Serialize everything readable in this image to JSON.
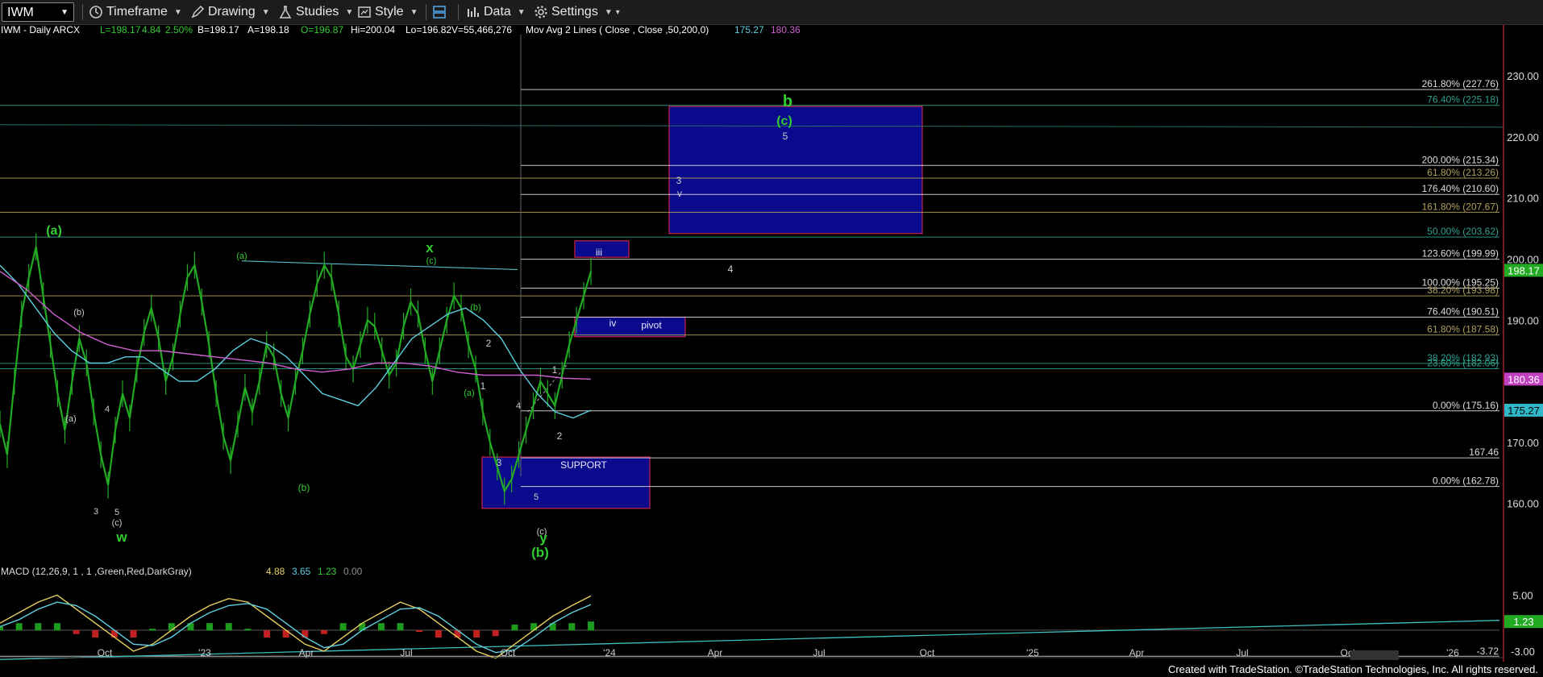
{
  "toolbar": {
    "symbol": "IWM",
    "timeframe": "Timeframe",
    "drawing": "Drawing",
    "studies": "Studies",
    "style": "Style",
    "data": "Data",
    "settings": "Settings"
  },
  "footer": "Created with TradeStation. ©TradeStation Technologies, Inc. All rights reserved.",
  "chart_data": {
    "type": "line",
    "header": {
      "symbol": "IWM - Daily  ARCX",
      "quote": [
        {
          "text": "L=198.17",
          "color": "#33cc33"
        },
        {
          "text": "4.84",
          "color": "#33cc33"
        },
        {
          "text": "2.50%",
          "color": "#33cc33"
        },
        {
          "text": "B=198.17",
          "color": "#ffffff"
        },
        {
          "text": "A=198.18",
          "color": "#ffffff"
        },
        {
          "text": "O=196.87",
          "color": "#33cc33"
        },
        {
          "text": "Hi=200.04",
          "color": "#ffffff"
        },
        {
          "text": "Lo=196.82",
          "color": "#ffffff"
        },
        {
          "text": "V=55,466,276",
          "color": "#ffffff"
        },
        {
          "text": "Mov Avg 2 Lines ( Close , Close ,50,200,0)",
          "color": "#ffffff"
        },
        {
          "text": "175.27",
          "color": "#5ecfe0"
        },
        {
          "text": "180.36",
          "color": "#d060d0"
        }
      ]
    },
    "x_ticks": [
      "Oct",
      "'23",
      "Apr",
      "Jul",
      "Oct",
      "'24",
      "Apr",
      "Jul",
      "Oct",
      "'25",
      "Apr",
      "Jul",
      "Oct",
      "'26"
    ],
    "price_axis": {
      "ylim": [
        156,
        232
      ],
      "ticks": [
        160,
        170,
        180,
        190,
        200,
        210,
        220,
        230
      ]
    },
    "price_series": {
      "name": "IWM",
      "color": "#22aa22",
      "values": [
        173,
        168,
        180,
        191,
        197,
        202,
        194,
        186,
        178,
        172,
        180,
        187,
        183,
        175,
        168,
        163,
        172,
        178,
        174,
        182,
        188,
        192,
        187,
        180,
        184,
        191,
        197,
        199,
        193,
        186,
        178,
        171,
        167,
        173,
        179,
        175,
        180,
        186,
        184,
        178,
        174,
        180,
        185,
        191,
        196,
        199,
        197,
        191,
        184,
        182,
        186,
        190,
        189,
        185,
        181,
        183,
        189,
        193,
        191,
        185,
        180,
        185,
        190,
        194,
        192,
        186,
        182,
        175,
        170,
        166,
        162,
        164,
        168,
        172,
        176,
        180,
        178,
        176,
        181,
        186,
        190,
        194,
        198
      ]
    },
    "ma_series": [
      {
        "name": "MA50",
        "color": "#5ecfe0",
        "values": [
          199,
          196,
          192,
          188,
          185,
          183,
          183,
          184,
          184,
          182,
          180,
          180,
          182,
          185,
          187,
          186,
          184,
          181,
          178,
          177,
          176,
          179,
          183,
          187,
          189,
          191,
          192,
          190,
          187,
          182,
          178,
          175,
          174,
          175.27
        ]
      },
      {
        "name": "MA200",
        "color": "#d060d0",
        "values": [
          198,
          195,
          191,
          188,
          186,
          185,
          185,
          184.5,
          184,
          183.5,
          183,
          182,
          181.5,
          182,
          183,
          183,
          182.5,
          181.5,
          181,
          181,
          181,
          180.5,
          180.36
        ]
      }
    ],
    "right_labels": [
      {
        "text": "198.17",
        "value": 198.17,
        "bg": "#22aa22",
        "fg": "#ffffff"
      },
      {
        "text": "180.36",
        "value": 180.36,
        "bg": "#c040c0",
        "fg": "#ffffff"
      },
      {
        "text": "175.27",
        "value": 175.27,
        "bg": "#30b8c8",
        "fg": "#000000"
      }
    ],
    "fib_levels": [
      {
        "text": "261.80% (227.76)",
        "value": 227.76,
        "color": "#dddddd"
      },
      {
        "text": "76.40% (225.18)",
        "value": 225.18,
        "color": "#2fa090"
      },
      {
        "text": "200.00% (215.34)",
        "value": 215.34,
        "color": "#dddddd"
      },
      {
        "text": "61.80% (213.26)",
        "value": 213.26,
        "color": "#b0a060"
      },
      {
        "text": "176.40% (210.60)",
        "value": 210.6,
        "color": "#dddddd"
      },
      {
        "text": "161.80% (207.67)",
        "value": 207.67,
        "color": "#b0a060"
      },
      {
        "text": "50.00% (203.62)",
        "value": 203.62,
        "color": "#2fa090"
      },
      {
        "text": "123.60% (199.99)",
        "value": 199.99,
        "color": "#dddddd"
      },
      {
        "text": "100.00% (195.25)",
        "value": 195.25,
        "color": "#dddddd"
      },
      {
        "text": "38.20% (193.98)",
        "value": 193.98,
        "color": "#b0a060"
      },
      {
        "text": "76.40% (190.51)",
        "value": 190.51,
        "color": "#dddddd"
      },
      {
        "text": "61.80% (187.58)",
        "value": 187.58,
        "color": "#b0a060"
      },
      {
        "text": "38.20% (182.93)",
        "value": 182.93,
        "color": "#2fa090"
      },
      {
        "text": "23.60% (182.06)",
        "value": 182.06,
        "color": "#2fa090"
      },
      {
        "text": "0.00% (175.16)",
        "value": 175.16,
        "color": "#dddddd"
      },
      {
        "text": "167.46",
        "value": 167.46,
        "color": "#dddddd"
      },
      {
        "text": "0.00% (162.78)",
        "value": 162.78,
        "color": "#dddddd"
      }
    ],
    "zones": [
      {
        "label": "",
        "price_top": 225,
        "price_bottom": 204.2
      },
      {
        "label": "iii",
        "price_top": 203,
        "price_bottom": 200.3
      },
      {
        "label": "iv",
        "price_top": 190.5,
        "price_bottom": 187.3
      },
      {
        "label": "pivot",
        "price_top": 190.5,
        "price_bottom": 187.3
      },
      {
        "label": "SUPPORT",
        "price_top": 167.6,
        "price_bottom": 159.2
      }
    ],
    "wave_labels": [
      {
        "text": "(a)",
        "color": "#33cc33"
      },
      {
        "text": "(b)",
        "color": "#cccccc"
      },
      {
        "text": "(a)",
        "color": "#cccccc"
      },
      {
        "text": "4",
        "color": "#cccccc"
      },
      {
        "text": "3",
        "color": "#cccccc"
      },
      {
        "text": "5",
        "color": "#cccccc"
      },
      {
        "text": "(c)",
        "color": "#cccccc"
      },
      {
        "text": "w",
        "color": "#33cc33"
      },
      {
        "text": "(a)",
        "color": "#33cc33"
      },
      {
        "text": "(b)",
        "color": "#33cc33"
      },
      {
        "text": "x",
        "color": "#33cc33"
      },
      {
        "text": "(c)",
        "color": "#33cc33"
      },
      {
        "text": "(b)",
        "color": "#33cc33"
      },
      {
        "text": "2",
        "color": "#cccccc"
      },
      {
        "text": "1",
        "color": "#cccccc"
      },
      {
        "text": "(a)",
        "color": "#33cc33"
      },
      {
        "text": "4",
        "color": "#cccccc"
      },
      {
        "text": "3",
        "color": "#cccccc"
      },
      {
        "text": "5",
        "color": "#cccccc"
      },
      {
        "text": "(c)",
        "color": "#cccccc"
      },
      {
        "text": "y",
        "color": "#33cc33"
      },
      {
        "text": "(b)",
        "color": "#33cc33"
      },
      {
        "text": "1",
        "color": "#cccccc"
      },
      {
        "text": "2",
        "color": "#cccccc"
      },
      {
        "text": "3",
        "color": "#cccccc"
      },
      {
        "text": "v",
        "color": "#cccccc"
      },
      {
        "text": "4",
        "color": "#cccccc"
      },
      {
        "text": "b",
        "color": "#33cc33"
      },
      {
        "text": "(c)",
        "color": "#33cc33"
      },
      {
        "text": "5",
        "color": "#cccccc"
      }
    ],
    "macd": {
      "title": "MACD (12,26,9, 1 , 1 ,Green,Red,DarkGray)",
      "values": [
        {
          "text": "4.88",
          "color": "#e8d060"
        },
        {
          "text": "3.65",
          "color": "#5ecfe0"
        },
        {
          "text": "1.23",
          "color": "#33cc33"
        },
        {
          "text": "0.00",
          "color": "#909090"
        }
      ],
      "ylim": [
        -4.5,
        7
      ],
      "ticks": [
        {
          "text": "5.00",
          "value": 5
        },
        {
          "text": "-3.00",
          "value": -3
        }
      ],
      "right_labels": [
        {
          "text": "1.23",
          "value": 1.23,
          "bg": "#22aa22"
        }
      ],
      "level_label": {
        "text": "-3.72",
        "value": -3.72
      },
      "macd_line": [
        1,
        2.5,
        4,
        5,
        3,
        1,
        -1,
        -3,
        -2,
        0,
        2,
        3.5,
        4.5,
        4,
        2,
        0,
        -2,
        -3,
        -1,
        1,
        2.5,
        4,
        3,
        1,
        -1,
        -3,
        -4,
        -2,
        0,
        2,
        3.5,
        4.88
      ],
      "signal_line": [
        0.5,
        1.5,
        3,
        4,
        3.5,
        2,
        0,
        -2,
        -2.2,
        -1,
        1,
        2.5,
        3.5,
        3.8,
        3,
        1,
        -1,
        -2.5,
        -2,
        0,
        1.5,
        3,
        3.2,
        2,
        0,
        -2,
        -3.2,
        -2.8,
        -1,
        1,
        2.5,
        3.65
      ],
      "histogram": [
        0.5,
        1,
        1,
        1,
        -0.5,
        -1,
        -1,
        -1,
        0.2,
        1,
        1,
        1,
        1,
        0.2,
        -1,
        -1,
        -1,
        -0.5,
        1,
        1,
        1,
        1,
        -0.2,
        -1,
        -1,
        -1,
        -0.8,
        0.8,
        1,
        1,
        1,
        1.23
      ]
    }
  }
}
